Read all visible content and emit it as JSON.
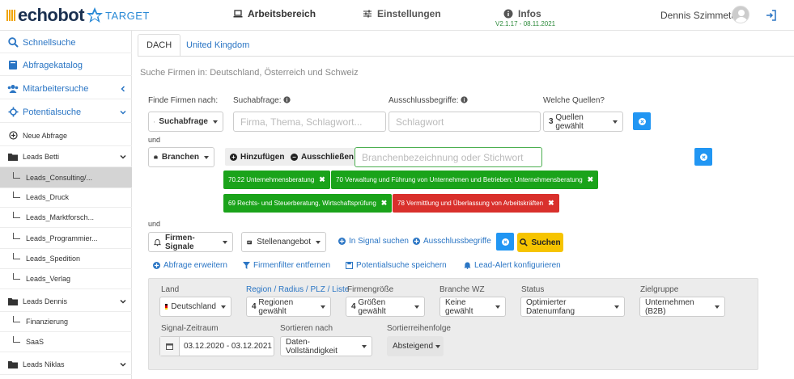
{
  "app": {
    "logo_text": "echobot",
    "logo_sub": "TARGET"
  },
  "topnav": {
    "workspace": "Arbeitsbereich",
    "settings": "Einstellungen",
    "infos": "Infos",
    "version": "V2.1.17 - 08.11.2021",
    "user": "Dennis Szimmetat"
  },
  "sidebar": {
    "items": [
      {
        "label": "Schnellsuche"
      },
      {
        "label": "Abfragekatalog"
      },
      {
        "label": "Mitarbeitersuche"
      },
      {
        "label": "Potentialsuche"
      },
      {
        "label": "Neue Abfrage"
      },
      {
        "label": "Leads Betti"
      },
      {
        "label": "Leads_Consulting/..."
      },
      {
        "label": "Leads_Druck"
      },
      {
        "label": "Leads_Marktforsch..."
      },
      {
        "label": "Leads_Programmier..."
      },
      {
        "label": "Leads_Spedition"
      },
      {
        "label": "Leads_Verlag"
      },
      {
        "label": "Leads Dennis"
      },
      {
        "label": "Finanzierung"
      },
      {
        "label": "SaaS"
      },
      {
        "label": "Leads Niklas"
      }
    ]
  },
  "tabs": [
    {
      "label": "DACH"
    },
    {
      "label": "United Kingdom"
    }
  ],
  "search_scope": "Suche Firmen in: Deutschland, Österreich und Schweiz",
  "row1": {
    "find_label": "Finde Firmen nach:",
    "query_label": "Suchabfrage:",
    "exclude_label": "Ausschlussbegriffe:",
    "sources_label": "Welche Quellen?",
    "mode": "Suchabfrage",
    "query_placeholder": "Firma, Thema, Schlagwort...",
    "exclude_placeholder": "Schlagwort",
    "sources_count": "3",
    "sources_text": "Quellen gewählt"
  },
  "und1": "und",
  "row2": {
    "mode": "Branchen",
    "add": "Hinzufügen",
    "exclude": "Ausschließen",
    "placeholder": "Branchenbezeichnung oder Stichwort"
  },
  "tags": [
    {
      "text": "70.22 Unternehmensberatung",
      "color": "green"
    },
    {
      "text": "70 Verwaltung und Führung von Unternehmen und Betrieben; Unternehmensberatung",
      "color": "green"
    },
    {
      "text": "69 Rechts- und Steuerberatung, Wirtschaftsprüfung",
      "color": "green"
    },
    {
      "text": "78 Vermittlung und Überlassung von Arbeitskräften",
      "color": "red"
    }
  ],
  "und2": "und",
  "row3": {
    "mode": "Firmen-Signale",
    "signal": "Stellenangebot",
    "in_signal": "In Signal suchen",
    "exclude_terms": "Ausschlussbegriffe",
    "search": "Suchen"
  },
  "actions": {
    "extend": "Abfrage erweitern",
    "filter_remove": "Firmenfilter entfernen",
    "save": "Potentialsuche speichern",
    "alert": "Lead-Alert konfigurieren"
  },
  "filters": {
    "country_label": "Land",
    "country_value": "Deutschland",
    "region_label": "Region / Radius / PLZ / Liste",
    "region_count": "4",
    "region_value": "Regionen gewählt",
    "size_label": "Firmengröße",
    "size_count": "4",
    "size_value": "Größen gewählt",
    "branch_label": "Branche WZ",
    "branch_value": "Keine gewählt",
    "status_label": "Status",
    "status_value": "Optimierter Datenumfang",
    "target_label": "Zielgruppe",
    "target_value": "Unternehmen (B2B)",
    "period_label": "Signal-Zeitraum",
    "period_value": "03.12.2020 - 03.12.2021",
    "sort_label": "Sortieren nach",
    "sort_value": "Daten-Vollständigkeit",
    "order_label": "Sortierreihenfolge",
    "order_value": "Absteigend"
  },
  "colors": {
    "accent": "#2196f3",
    "green": "#1aa31a",
    "red": "#d9302c",
    "yellow": "#f6c400"
  }
}
